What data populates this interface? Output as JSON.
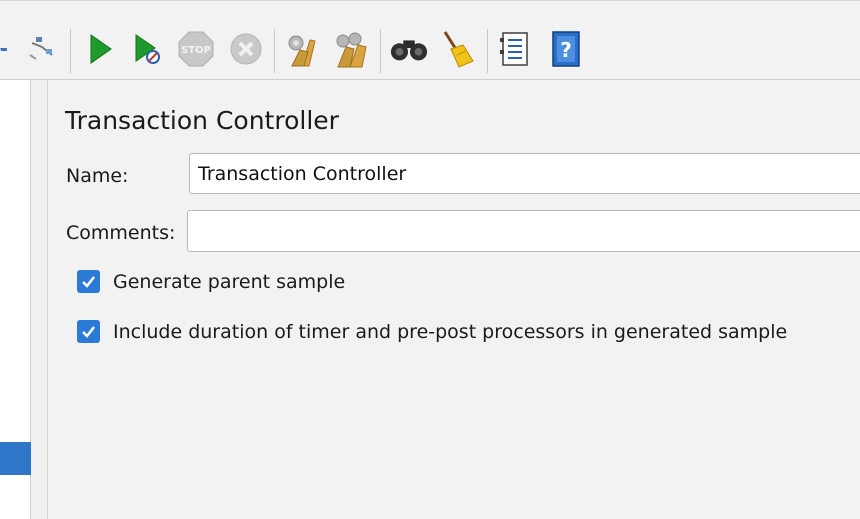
{
  "toolbar": {
    "items": [
      {
        "name": "expand-tree-icon",
        "interactable": true
      },
      {
        "name": "toggle-icon",
        "interactable": true
      },
      {
        "name": "start-icon",
        "interactable": true
      },
      {
        "name": "start-no-pauses-icon",
        "interactable": true
      },
      {
        "name": "stop-icon",
        "interactable": true
      },
      {
        "name": "shutdown-icon",
        "interactable": true
      },
      {
        "name": "clear-icon",
        "interactable": true
      },
      {
        "name": "clear-all-icon",
        "interactable": true
      },
      {
        "name": "search-icon",
        "interactable": true
      },
      {
        "name": "reset-search-icon",
        "interactable": true
      },
      {
        "name": "function-helper-icon",
        "interactable": true
      },
      {
        "name": "help-icon",
        "interactable": true
      }
    ],
    "stop_text": "STOP",
    "help_text": "?"
  },
  "panel": {
    "title": "Transaction Controller",
    "name_label": "Name:",
    "name_value": "Transaction Controller",
    "comments_label": "Comments:",
    "comments_value": "",
    "options": [
      {
        "label": "Generate parent sample",
        "checked": true
      },
      {
        "label": "Include duration of timer and pre-post processors in generated sample",
        "checked": true
      }
    ]
  },
  "colors": {
    "accent": "#2a7ad6",
    "tree_selection": "#2f76c8",
    "start_green": "#1e9b2a"
  }
}
